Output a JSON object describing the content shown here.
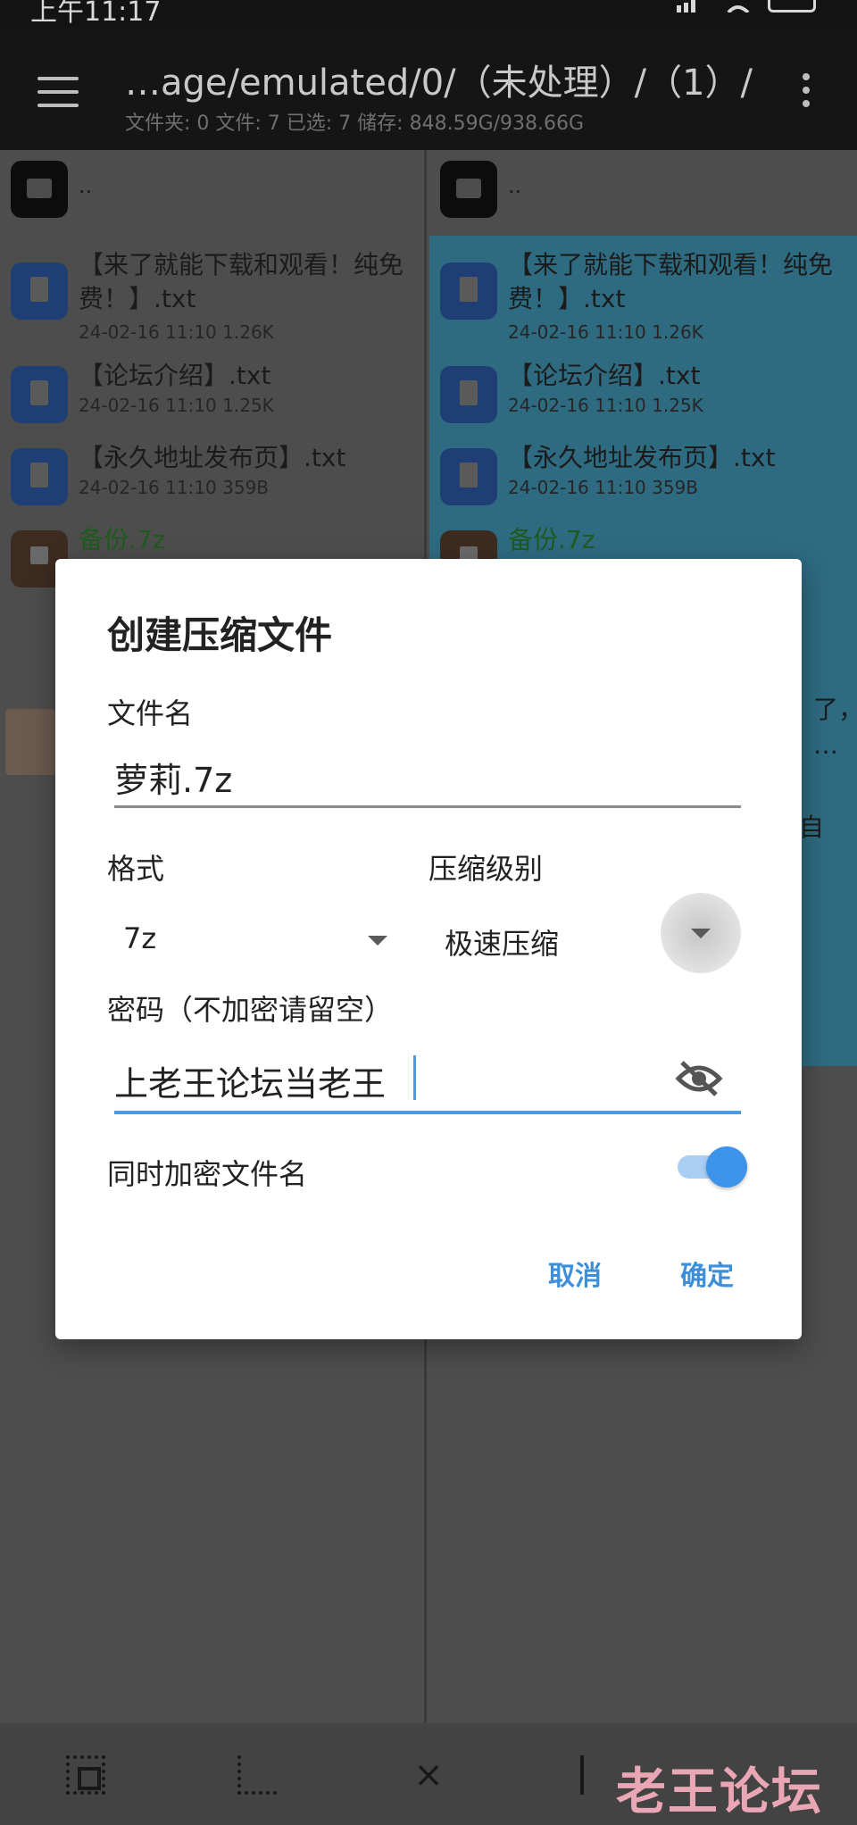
{
  "status_bar": {
    "time": "上午11:17"
  },
  "app_bar": {
    "path": "…age/emulated/0/（未处理）/（1）/",
    "stats": "文件夹: 0  文件: 7  已选: 7  储存: 848.59G/938.66G"
  },
  "left_pane": {
    "parent_dir": "..",
    "files": [
      {
        "name": "【来了就能下载和观看！纯免费！】.txt",
        "meta": "24-02-16 11:10  1.26K"
      },
      {
        "name": "【论坛介绍】.txt",
        "meta": "24-02-16 11:10  1.25K"
      },
      {
        "name": "【永久地址发布页】.txt",
        "meta": "24-02-16 11:10  359B"
      },
      {
        "name": "备份.7z",
        "meta": ""
      }
    ]
  },
  "right_pane": {
    "parent_dir": "..",
    "files": [
      {
        "name": "【来了就能下载和观看！纯免费！】.txt",
        "meta": "24-02-16 11:10  1.26K"
      },
      {
        "name": "【论坛介绍】.txt",
        "meta": "24-02-16 11:10  1.25K"
      },
      {
        "name": "【永久地址发布页】.txt",
        "meta": "24-02-16 11:10  359B"
      },
      {
        "name": "备份.7z",
        "meta": ""
      }
    ],
    "partial_text": {
      "line1": "了，",
      "line2": "…",
      "line3": "自"
    }
  },
  "dialog": {
    "title": "创建压缩文件",
    "filename_label": "文件名",
    "filename_value": "萝莉.7z",
    "format_label": "格式",
    "format_value": "7z",
    "level_label": "压缩级别",
    "level_value": "极速压缩",
    "password_label": "密码（不加密请留空）",
    "password_value": "上老王论坛当老王",
    "encrypt_names_label": "同时加密文件名",
    "encrypt_names_on": true,
    "cancel_label": "取消",
    "ok_label": "确定"
  },
  "watermark": "老王论坛",
  "icons": {
    "menu": "menu-icon",
    "more": "more-vertical-icon",
    "folder": "folder-icon",
    "document": "document-icon",
    "archive": "archive-icon",
    "dropdown": "chevron-down-icon",
    "visibility_off": "eye-off-icon",
    "select_all": "select-all-icon",
    "select_region": "select-region-icon",
    "close": "close-icon"
  },
  "colors": {
    "accent": "#3d93ea",
    "selection": "#2e6a80",
    "watermark": "#e9a6b5"
  }
}
